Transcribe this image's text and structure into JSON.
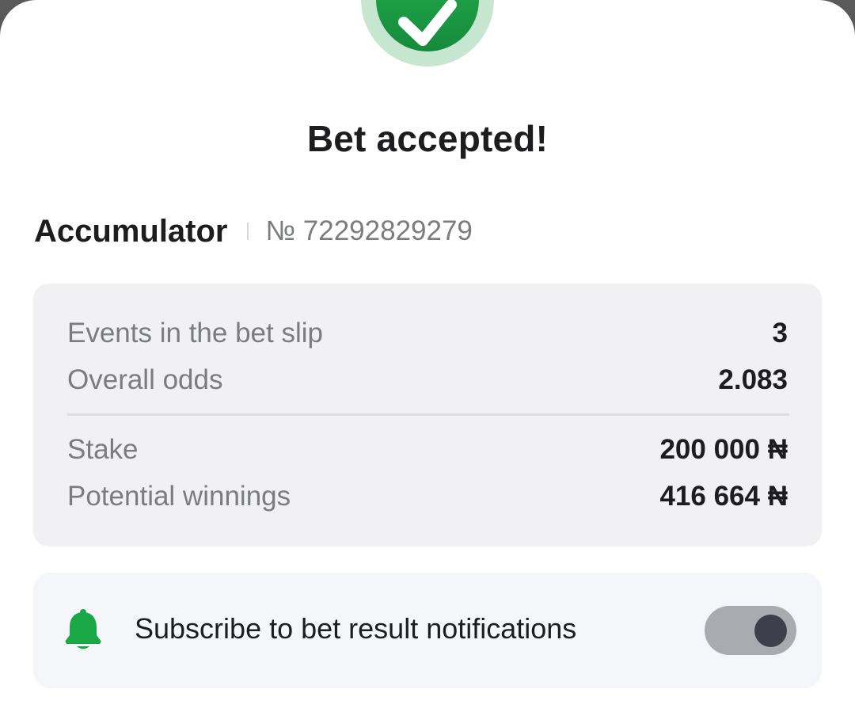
{
  "sheet": {
    "title": "Bet accepted!"
  },
  "bet": {
    "type": "Accumulator",
    "number": "№ 72292829279"
  },
  "summary": {
    "rows": [
      {
        "label": "Events in the bet slip",
        "value": "3"
      },
      {
        "label": "Overall odds",
        "value": "2.083"
      },
      {
        "label": "Stake",
        "value": "200 000 ₦"
      },
      {
        "label": "Potential winnings",
        "value": "416 664 ₦"
      }
    ]
  },
  "notifications": {
    "label": "Subscribe to bet result notifications",
    "toggle_on": true
  },
  "icons": {
    "success": "check-circle-icon",
    "notify": "bell-icon"
  },
  "colors": {
    "success_green": "#1fa046",
    "success_ring": "#c6e6d0",
    "bell_green": "#1aa846",
    "toggle_track": "#a9abb1",
    "toggle_knob": "#3d3f4a"
  }
}
